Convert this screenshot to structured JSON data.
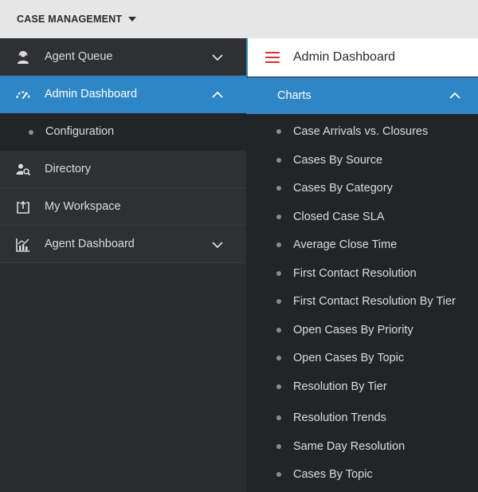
{
  "topbar": {
    "app_title": "CASE MANAGEMENT"
  },
  "sidebar": {
    "items": [
      {
        "label": "Agent Queue",
        "icon": "agent-icon",
        "expandable": true,
        "expanded": false
      },
      {
        "label": "Admin Dashboard",
        "icon": "speedometer-icon",
        "expandable": true,
        "expanded": true,
        "active": true,
        "children": [
          {
            "label": "Configuration"
          }
        ]
      },
      {
        "label": "Directory",
        "icon": "person-search-icon"
      },
      {
        "label": "My Workspace",
        "icon": "workspace-icon"
      },
      {
        "label": "Agent Dashboard",
        "icon": "analytics-icon",
        "expandable": true,
        "expanded": false
      }
    ]
  },
  "panel": {
    "title": "Admin Dashboard",
    "section": {
      "label": "Charts",
      "items": [
        "Case Arrivals vs. Closures",
        "Cases By Source",
        "Cases By Category",
        "Closed Case SLA",
        "Average Close Time",
        "First Contact Resolution",
        "First Contact Resolution By Tier",
        "Open Cases By Priority",
        "Open Cases By Topic",
        "Resolution By Tier",
        "Resolution Trends",
        "Same Day Resolution",
        "Cases By Topic"
      ]
    }
  },
  "colors": {
    "accent": "#2f86c6",
    "menu_icon": "#d6312f"
  }
}
